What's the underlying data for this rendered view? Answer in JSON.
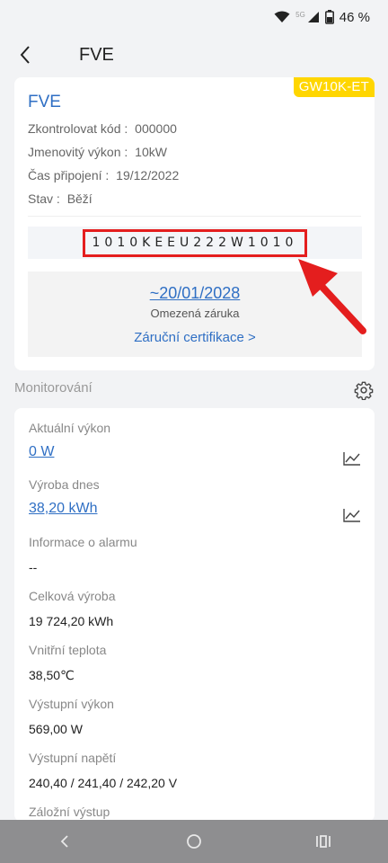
{
  "status_bar": {
    "network_label": "5G",
    "battery": "46 %"
  },
  "header": {
    "title": "FVE"
  },
  "device": {
    "model_badge": "GW10K-ET",
    "name": "FVE",
    "check_code_label": "Zkontrolovat kód :",
    "check_code_value": "000000",
    "rated_power_label": "Jmenovitý výkon :",
    "rated_power_value": "10kW",
    "connection_time_label": "Čas připojení :",
    "connection_time_value": "19/12/2022",
    "status_label": "Stav :",
    "status_value": "Běží",
    "serial_number": "1010KEEU222W1010",
    "warranty_date": "~20/01/2028",
    "warranty_label": "Omezená záruka",
    "warranty_cert_link": "Záruční certifikace  >"
  },
  "monitoring": {
    "title": "Monitorování",
    "metrics": [
      {
        "label": "Aktuální výkon",
        "value": "0 W"
      },
      {
        "label": "Výroba dnes",
        "value": "38,20 kWh"
      },
      {
        "label": "Informace o alarmu",
        "value": "--"
      },
      {
        "label": "Celková výroba",
        "value": "19 724,20 kWh"
      },
      {
        "label": "Vnitřní teplota",
        "value": "38,50℃"
      },
      {
        "label": "Výstupní výkon",
        "value": "569,00 W"
      },
      {
        "label": "Výstupní napětí",
        "value": "240,40  / 241,40  / 242,20 V"
      },
      {
        "label": "Záložní výstup",
        "value": ""
      }
    ]
  },
  "icons": {
    "back": "chevron-left-icon",
    "settings": "gear-icon",
    "chart": "line-chart-icon",
    "nav_back": "nav-back-icon",
    "nav_home": "nav-home-icon",
    "nav_recents": "nav-recents-icon"
  },
  "colors": {
    "accent_blue": "#2f6fc4",
    "badge_yellow": "#ffd600",
    "highlight_red": "#e41e1e",
    "navbar_gray": "#8e8e90"
  }
}
